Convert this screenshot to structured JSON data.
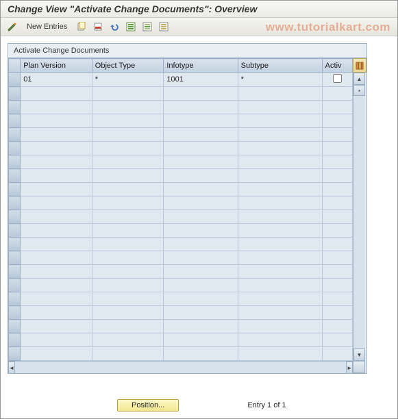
{
  "header": {
    "title": "Change View \"Activate Change Documents\": Overview"
  },
  "toolbar": {
    "new_entries_label": "New Entries"
  },
  "watermark": "www.tutorialkart.com",
  "panel": {
    "title": "Activate Change Documents",
    "columns": {
      "plan_version": "Plan Version",
      "object_type": "Object Type",
      "infotype": "Infotype",
      "subtype": "Subtype",
      "active": "Activ"
    },
    "rows": [
      {
        "plan_version": "01",
        "object_type": "*",
        "infotype": "1001",
        "subtype": "*",
        "active": false
      }
    ],
    "empty_row_count": 20
  },
  "footer": {
    "position_label": "Position...",
    "entry_text": "Entry 1 of 1"
  }
}
